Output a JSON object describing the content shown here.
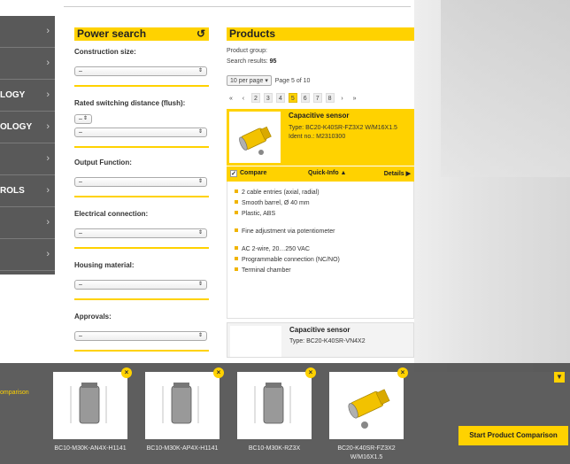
{
  "nav": {
    "items": [
      {
        "label": "",
        "chev": "›"
      },
      {
        "label": "",
        "chev": "›"
      },
      {
        "label": "LOGY",
        "chev": "›"
      },
      {
        "label": "OLOGY",
        "chev": "›"
      },
      {
        "label": "",
        "chev": "›"
      },
      {
        "label": "ROLS",
        "chev": "›"
      },
      {
        "label": "",
        "chev": "›"
      },
      {
        "label": "",
        "chev": "›"
      }
    ]
  },
  "power_search": {
    "title": "Power search",
    "reset_icon": "↺",
    "filters": [
      {
        "label": "Construction size:",
        "value": "–"
      },
      {
        "label": "Rated switching distance (flush):",
        "value": "–",
        "value2": "–"
      },
      {
        "label": "Output Function:",
        "value": "–"
      },
      {
        "label": "Electrical connection:",
        "value": "–"
      },
      {
        "label": "Housing material:",
        "value": "–"
      },
      {
        "label": "Approvals:",
        "value": "–"
      }
    ]
  },
  "products": {
    "title": "Products",
    "group_label": "Product group:",
    "results_label": "Search results:",
    "results_count": "95",
    "per_page": "10 per page",
    "page_info": "Page 5 of 10",
    "pager": {
      "first": "«",
      "prev": "‹",
      "pages": [
        "2",
        "3",
        "4",
        "5",
        "6",
        "7",
        "8"
      ],
      "current": "5",
      "next": "›",
      "last": "»"
    },
    "card1": {
      "title": "Capacitive sensor",
      "type": "Type: BC20-K40SR-FZ3X2 W/M16X1.5",
      "ident": "Ident no.: M2310300",
      "compare": "Compare",
      "quickinfo": "Quick-Info ▲",
      "details": "Details ▶",
      "bullets1": [
        "2 cable entries (axial, radial)",
        "Smooth barrel, Ø 40 mm",
        "Plastic, ABS"
      ],
      "bullets2": [
        "Fine adjustment via potentiometer"
      ],
      "bullets3": [
        "AC 2-wire, 20…250 VAC",
        "Programmable connection (NC/NO)",
        "Terminal chamber"
      ]
    },
    "card2": {
      "title": "Capacitive sensor",
      "type": "Type: BC20-K40SR-VN4X2"
    }
  },
  "comparison": {
    "label": "omparison",
    "toggle": "▼",
    "remove_icon": "×",
    "items": [
      "BC10-M30K-AN4X-H1141",
      "BC10-M30K-AP4X-H1141",
      "BC10-M30K-RZ3X",
      "BC20-K40SR-FZ3X2 W/M16X1.5"
    ],
    "start_button": "Start Product Comparison"
  }
}
